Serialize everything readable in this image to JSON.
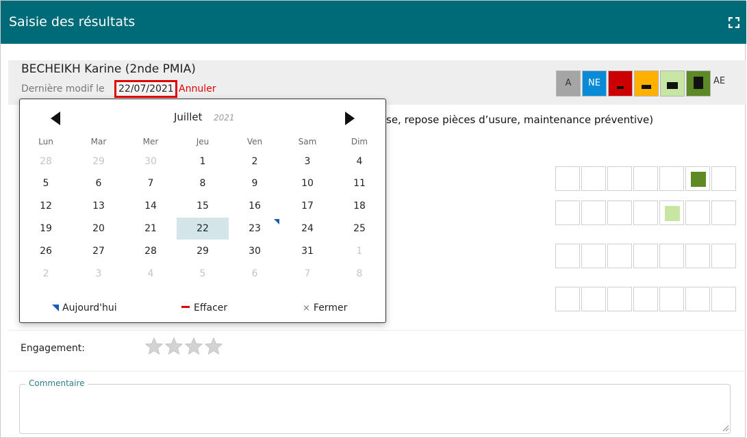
{
  "header": {
    "title": "Saisie des résultats"
  },
  "student": {
    "name": "BECHEIKH Karine (2nde PMIA)",
    "last_modified_label": "Dernière modif le",
    "last_modified_date": "22/07/2021",
    "cancel_label": "Annuler"
  },
  "level_legend": {
    "items": [
      {
        "label": "A",
        "color": "#a5a5a5"
      },
      {
        "label": "NE",
        "color": "#0a8bd8"
      },
      {
        "label": "",
        "color": "#cc0000"
      },
      {
        "label": "",
        "color": "#ffb000"
      },
      {
        "label": "",
        "color": "#c8e6a3"
      },
      {
        "label": "",
        "color": "#5d8a24"
      }
    ],
    "ae_label": "AE"
  },
  "competence": {
    "text_visible": "se, repose pièces d’usure, maintenance préventive)"
  },
  "evaluation_grid": {
    "rows": [
      {
        "selected_index": 5,
        "selected_color": "#5d8a24"
      },
      {
        "selected_index": 4,
        "selected_color": "#c8e6a3"
      },
      {
        "selected_index": null,
        "selected_color": ""
      },
      {
        "selected_index": null,
        "selected_color": ""
      }
    ]
  },
  "engagement": {
    "label": "Engagement:",
    "rating": 0,
    "max": 4
  },
  "comment": {
    "legend": "Commentaire",
    "value": ""
  },
  "calendar": {
    "month": "Juillet",
    "year": "2021",
    "weekdays": [
      "Lun",
      "Mar",
      "Mer",
      "Jeu",
      "Ven",
      "Sam",
      "Dim"
    ],
    "weeks": [
      [
        "28",
        "29",
        "30",
        "1",
        "2",
        "3",
        "4"
      ],
      [
        "5",
        "6",
        "7",
        "8",
        "9",
        "10",
        "11"
      ],
      [
        "12",
        "13",
        "14",
        "15",
        "16",
        "17",
        "18"
      ],
      [
        "19",
        "20",
        "21",
        "22",
        "23",
        "24",
        "25"
      ],
      [
        "26",
        "27",
        "28",
        "29",
        "30",
        "31",
        "1"
      ],
      [
        "2",
        "3",
        "4",
        "5",
        "6",
        "7",
        "8"
      ]
    ],
    "selected_day": "22",
    "today_day": "23",
    "today_label": "Aujourd'hui",
    "clear_label": "Effacer",
    "close_label": "Fermer"
  }
}
